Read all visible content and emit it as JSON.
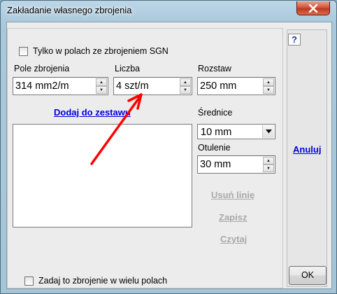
{
  "window": {
    "title": "Zakładanie własnego zbrojenia"
  },
  "form": {
    "sgn_checkbox_label": "Tylko w polach ze zbrojeniem SGN",
    "sgn_checked": false,
    "pole_label": "Pole zbrojenia",
    "pole_value": "314 mm2/m",
    "liczba_label": "Liczba",
    "liczba_value": "4 szt/m",
    "rozstaw_label": "Rozstaw",
    "rozstaw_value": "250 mm",
    "add_link": "Dodaj do zestawu",
    "srednice_label": "Średnice",
    "srednice_value": "10 mm",
    "otulenie_label": "Otulenie",
    "otulenie_value": "30 mm",
    "usun_link": "Usuń linię",
    "zapisz_link": "Zapisz",
    "czytaj_link": "Czytaj",
    "multi_checkbox_label": "Zadaj to zbrojenie w wielu polach",
    "multi_checked": false
  },
  "side": {
    "help_label": "?",
    "anuluj_link": "Anuluj",
    "ok_label": "OK"
  },
  "colors": {
    "link": "#0000e0",
    "disabled_link": "#a9a9a9",
    "annotation_arrow": "#ff0000",
    "close_button": "#c9452a"
  },
  "icons": {
    "close": "close-x-icon",
    "spin": "spin-up-down-arrows",
    "dropdown": "chevron-down-icon"
  }
}
